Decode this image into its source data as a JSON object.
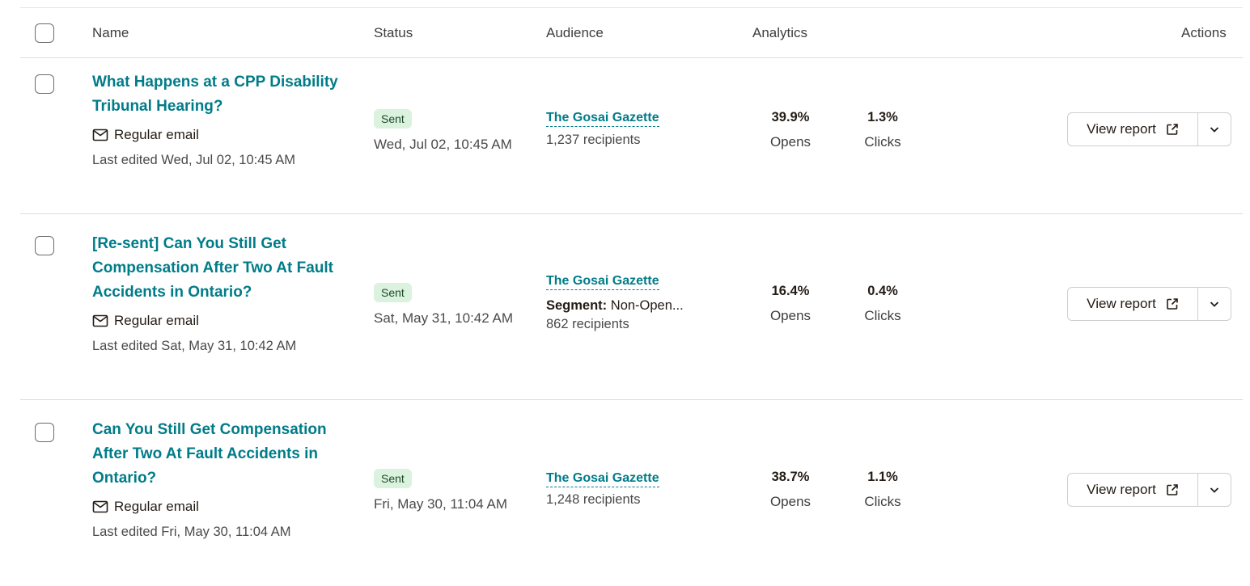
{
  "header": {
    "name": "Name",
    "status": "Status",
    "audience": "Audience",
    "analytics": "Analytics",
    "actions": "Actions"
  },
  "colors": {
    "link": "#007c89",
    "badge_bg": "#dbf2df",
    "badge_text": "#1d4a26"
  },
  "icons": {
    "email": "envelope-icon",
    "external": "external-link-icon",
    "caret": "chevron-down-icon"
  },
  "campaigns": [
    {
      "title_line1": "What Happens at a CPP Disability",
      "title_line2": "Tribunal Hearing?",
      "title_line3": "",
      "type": "Regular email",
      "edited": "Last edited Wed, Jul 02, 10:45 AM",
      "status": "Sent",
      "status_date": "Wed, Jul 02, 10:45 AM",
      "audience": "The Gosai Gazette",
      "segment_label": "",
      "segment_value": "",
      "recipients": "1,237 recipients",
      "opens": "39.9%",
      "opens_label": "Opens",
      "clicks": "1.3%",
      "clicks_label": "Clicks",
      "action": "View report"
    },
    {
      "title_line1": "[Re-sent] Can You Still Get",
      "title_line2": "Compensation After Two At Fault",
      "title_line3": "Accidents in Ontario?",
      "type": "Regular email",
      "edited": "Last edited Sat, May 31, 10:42 AM",
      "status": "Sent",
      "status_date": "Sat, May 31, 10:42 AM",
      "audience": "The Gosai Gazette",
      "segment_label": "Segment:",
      "segment_value": " Non-Open...",
      "recipients": "862 recipients",
      "opens": "16.4%",
      "opens_label": "Opens",
      "clicks": "0.4%",
      "clicks_label": "Clicks",
      "action": "View report"
    },
    {
      "title_line1": "Can You Still Get Compensation",
      "title_line2": "After Two At Fault Accidents in",
      "title_line3": "Ontario?",
      "type": "Regular email",
      "edited": "Last edited Fri, May 30, 11:04 AM",
      "status": "Sent",
      "status_date": "Fri, May 30, 11:04 AM",
      "audience": "The Gosai Gazette",
      "segment_label": "",
      "segment_value": "",
      "recipients": "1,248 recipients",
      "opens": "38.7%",
      "opens_label": "Opens",
      "clicks": "1.1%",
      "clicks_label": "Clicks",
      "action": "View report"
    }
  ]
}
